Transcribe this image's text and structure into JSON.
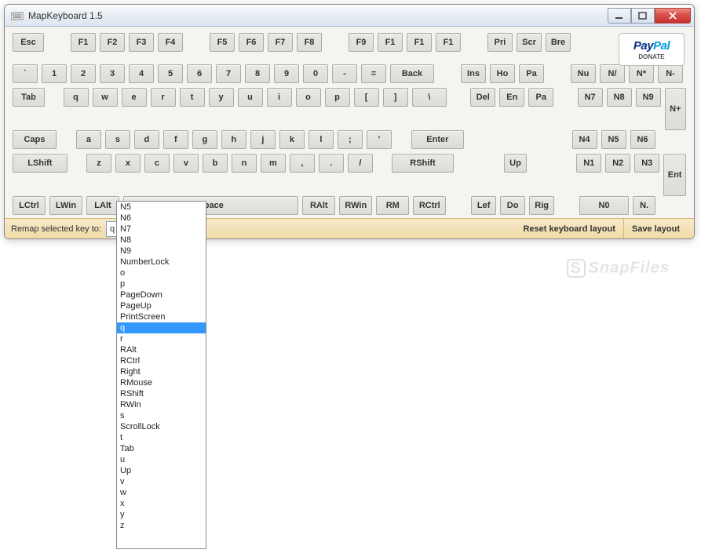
{
  "title": "MapKeyboard 1.5",
  "paypal": {
    "brand_p": "Pay",
    "brand_a": "Pal",
    "donate": "DONATE"
  },
  "rows": {
    "fn1": [
      "Esc"
    ],
    "fn2": [
      "F1",
      "F2",
      "F3",
      "F4"
    ],
    "fn3": [
      "F5",
      "F6",
      "F7",
      "F8"
    ],
    "fn4": [
      "F9",
      "F1",
      "F1",
      "F1"
    ],
    "fn5": [
      "Pri",
      "Scr",
      "Bre"
    ],
    "num1_a": [
      "`",
      "1",
      "2",
      "3",
      "4",
      "5",
      "6",
      "7",
      "8",
      "9",
      "0",
      "-",
      "="
    ],
    "num1_back": "Back",
    "num1_b": [
      "Ins",
      "Ho",
      "Pa"
    ],
    "num1_c": [
      "Nu",
      "N/",
      "N*"
    ],
    "num1_nminus": "N-",
    "tab_a": [
      "Tab"
    ],
    "tab_b": [
      "q",
      "w",
      "e",
      "r",
      "t",
      "y",
      "u",
      "i",
      "o",
      "p",
      "[",
      "]"
    ],
    "tab_bslash": "\\",
    "tab_c": [
      "Del",
      "En",
      "Pa"
    ],
    "tab_d": [
      "N7",
      "N8",
      "N9"
    ],
    "nplus": "N+",
    "caps_a": "Caps",
    "caps_b": [
      "a",
      "s",
      "d",
      "f",
      "g",
      "h",
      "j",
      "k",
      "l",
      ";",
      "'"
    ],
    "caps_enter": "Enter",
    "caps_c": [
      "N4",
      "N5",
      "N6"
    ],
    "shift_a": "LShift",
    "shift_b": [
      "z",
      "x",
      "c",
      "v",
      "b",
      "n",
      "m",
      ",",
      ".",
      "/"
    ],
    "shift_r": "RShift",
    "shift_up": "Up",
    "shift_c": [
      "N1",
      "N2",
      "N3"
    ],
    "ent": "Ent",
    "ctrl_a": [
      "LCtrl",
      "LWin",
      "LAlt"
    ],
    "ctrl_space": "Space",
    "ctrl_b": [
      "RAlt",
      "RWin",
      "RM",
      "RCtrl"
    ],
    "ctrl_c": [
      "Lef",
      "Do",
      "Rig"
    ],
    "ctrl_d": "N0",
    "ctrl_e": "N."
  },
  "footer": {
    "label": "Remap selected key to:",
    "value": "q",
    "reset": "Reset keyboard layout",
    "save": "Save layout"
  },
  "dropdown": {
    "selected": "q",
    "items": [
      "N5",
      "N6",
      "N7",
      "N8",
      "N9",
      "NumberLock",
      "o",
      "p",
      "PageDown",
      "PageUp",
      "PrintScreen",
      "q",
      "r",
      "RAlt",
      "RCtrl",
      "Right",
      "RMouse",
      "RShift",
      "RWin",
      "s",
      "ScrollLock",
      "t",
      "Tab",
      "u",
      "Up",
      "v",
      "w",
      "x",
      "y",
      "z"
    ]
  },
  "watermark": "SnapFiles"
}
